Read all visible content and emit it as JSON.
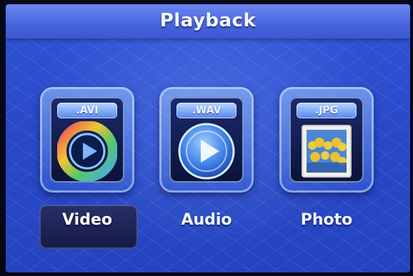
{
  "header": {
    "title": "Playback"
  },
  "menu": {
    "items": [
      {
        "label": "Video",
        "format": ".AVI",
        "icon": "video-play-icon",
        "selected": true
      },
      {
        "label": "Audio",
        "format": ".WAV",
        "icon": "audio-play-icon",
        "selected": false
      },
      {
        "label": "Photo",
        "format": ".JPG",
        "icon": "photo-thumbnail-icon",
        "selected": false
      }
    ]
  },
  "colors": {
    "background": "#2a49c9",
    "title_bar": "#4a67de",
    "selection": "#1e2457"
  }
}
